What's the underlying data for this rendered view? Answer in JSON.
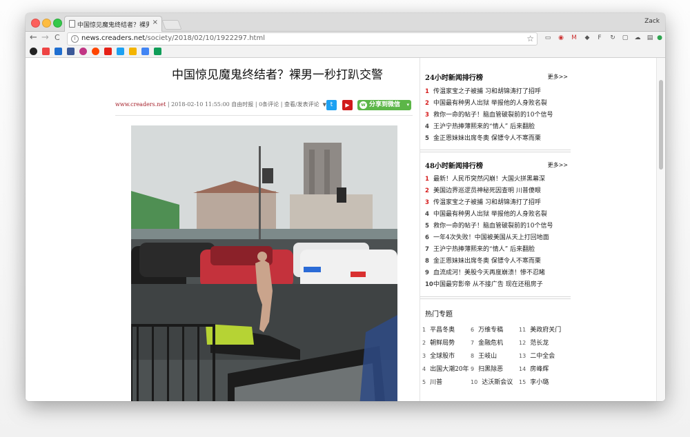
{
  "browser": {
    "tab_title": "中国惊见魔鬼终结者？裸男一秒",
    "tab_close": "×",
    "user": "Zack",
    "url_host": "news.creaders.net",
    "url_path": "/society/2018/02/10/1922297.html",
    "info_icon": "i",
    "nav_back": "←",
    "nav_forward": "→",
    "nav_reload": "C",
    "star": "☆"
  },
  "article": {
    "title": "中国惊见魔鬼终结者？裸男一秒打趴交警",
    "site": "www.creaders.net",
    "meta_rest": " | 2018-02-10 11:55:00  自由时报 | 0条评论 | 查看/发表评论",
    "caret": "▼",
    "share_wechat": "分享到微信",
    "share_wechat_arrow": "▾",
    "twitter_glyph": "t",
    "youtube_glyph": "▶",
    "wechat_glyph": "w"
  },
  "sidebar": {
    "rank24": {
      "title": "24小时新闻排行榜",
      "more": "更多>>",
      "items": [
        {
          "num": "1",
          "text": "传温家宝之子被捕 习和胡锦涛打了招呼"
        },
        {
          "num": "2",
          "text": "中国最有种男人出狱 举报他的人身败名裂"
        },
        {
          "num": "3",
          "text": "救你一命的帖子！脑血管破裂前的10个信号"
        },
        {
          "num": "4",
          "text": "王沪宁热捧薄熙来的“情人” 后来翻脸"
        },
        {
          "num": "5",
          "text": "金正恩妹妹出席冬奥 保镖令人不寒而栗"
        }
      ]
    },
    "rank48": {
      "title": "48小时新闻排行榜",
      "more": "更多>>",
      "items": [
        {
          "num": "1",
          "text": "最新！人民币突然闪崩！大国火拼黑幕深"
        },
        {
          "num": "2",
          "text": "美国边界巡逻员神秘死因查明 川普傻眼"
        },
        {
          "num": "3",
          "text": "传温家宝之子被捕 习和胡锦涛打了招呼"
        },
        {
          "num": "4",
          "text": "中国最有种男人出狱 举报他的人身败名裂"
        },
        {
          "num": "5",
          "text": "救你一命的帖子！脑血管破裂前的10个信号"
        },
        {
          "num": "6",
          "text": "一年4次失败！中国被美国从天上打回地面"
        },
        {
          "num": "7",
          "text": "王沪宁热捧薄熙来的“情人” 后来翻脸"
        },
        {
          "num": "8",
          "text": "金正恩妹妹出席冬奥 保镖令人不寒而栗"
        },
        {
          "num": "9",
          "text": "血流成河！美股今天再度崩溃！惨不忍睹"
        },
        {
          "num": "10",
          "text": "中国最穷影帝 从不接广告 现在还租房子"
        }
      ]
    },
    "topics": {
      "title": "热门专题",
      "items": [
        {
          "num": "1",
          "text": "平昌冬奥"
        },
        {
          "num": "6",
          "text": "万维专稿"
        },
        {
          "num": "11",
          "text": "美政府关门"
        },
        {
          "num": "2",
          "text": "朝鲜局势"
        },
        {
          "num": "7",
          "text": "金融危机"
        },
        {
          "num": "12",
          "text": "范长龙"
        },
        {
          "num": "3",
          "text": "全球股市"
        },
        {
          "num": "8",
          "text": "王岐山"
        },
        {
          "num": "13",
          "text": "二中全会"
        },
        {
          "num": "4",
          "text": "出国大潮20年"
        },
        {
          "num": "9",
          "text": "扫黑除恶"
        },
        {
          "num": "14",
          "text": "房峰辉"
        },
        {
          "num": "5",
          "text": "川普"
        },
        {
          "num": "10",
          "text": "达沃斯会议"
        },
        {
          "num": "15",
          "text": "李小璐"
        }
      ]
    }
  }
}
